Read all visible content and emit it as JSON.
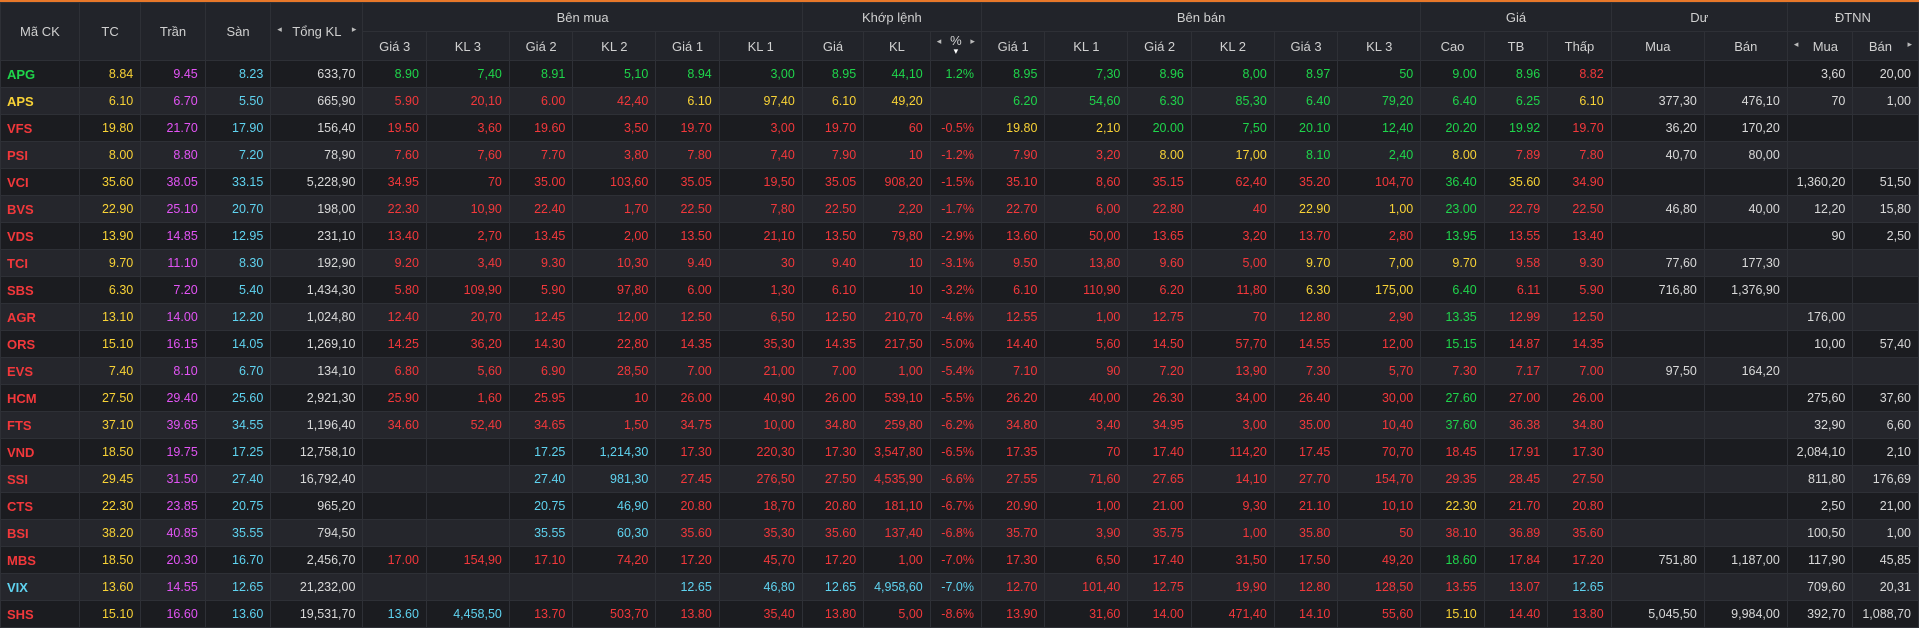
{
  "colors": {
    "up": "#1fd54b",
    "down": "#f2383b",
    "ref": "#f8d236",
    "ceil": "#e354f5",
    "floor": "#5fd3f0",
    "neutral": "#d9d9d9"
  },
  "headers": {
    "symbol": "Mã CK",
    "tc": "TC",
    "tran": "Trần",
    "san": "Sàn",
    "tong_kl": "Tổng KL",
    "ben_mua": "Bên mua",
    "khop_lenh": "Khớp lệnh",
    "ben_ban": "Bên bán",
    "gia": "Giá",
    "du": "Dư",
    "dtnn": "ĐTNN",
    "gia3": "Giá 3",
    "kl3": "KL 3",
    "gia2": "Giá 2",
    "kl2": "KL 2",
    "gia1": "Giá 1",
    "kl1": "KL 1",
    "m_gia": "Giá",
    "m_kl": "KL",
    "m_pct": "%",
    "cao": "Cao",
    "tb": "TB",
    "thap": "Thấp",
    "du_mua": "Mua",
    "du_ban": "Bán",
    "nn_mua": "Mua",
    "nn_ban": "Bán",
    "sort_icon": "▾",
    "left_arrow": "◂",
    "right_arrow": "▸"
  },
  "rows": [
    {
      "sym": [
        "APG",
        "u"
      ],
      "tc": "8.84",
      "tran": "9.45",
      "san": "8.23",
      "kl": "633,70",
      "b3": [
        "8.90",
        "7,40",
        "u"
      ],
      "b2": [
        "8.91",
        "5,10",
        "u"
      ],
      "b1": [
        "8.94",
        "3,00",
        "u"
      ],
      "m": [
        "8.95",
        "44,10",
        "1.2%",
        "u"
      ],
      "s1": [
        "8.95",
        "7,30",
        "u"
      ],
      "s2": [
        "8.96",
        "8,00",
        "u"
      ],
      "s3": [
        "8.97",
        "50",
        "u"
      ],
      "cao": [
        "9.00",
        "u"
      ],
      "tb": [
        "8.96",
        "u"
      ],
      "thap": [
        "8.82",
        "d"
      ],
      "dm": "",
      "db": "",
      "nm": "3,60",
      "nb": "20,00"
    },
    {
      "sym": [
        "APS",
        "r"
      ],
      "tc": "6.10",
      "tran": "6.70",
      "san": "5.50",
      "kl": "665,90",
      "b3": [
        "5.90",
        "20,10",
        "d"
      ],
      "b2": [
        "6.00",
        "42,40",
        "d"
      ],
      "b1": [
        "6.10",
        "97,40",
        "r"
      ],
      "m": [
        "6.10",
        "49,20",
        "",
        "r"
      ],
      "s1": [
        "6.20",
        "54,60",
        "u"
      ],
      "s2": [
        "6.30",
        "85,30",
        "u"
      ],
      "s3": [
        "6.40",
        "79,20",
        "u"
      ],
      "cao": [
        "6.40",
        "u"
      ],
      "tb": [
        "6.25",
        "u"
      ],
      "thap": [
        "6.10",
        "r"
      ],
      "dm": "377,30",
      "db": "476,10",
      "nm": "70",
      "nb": "1,00"
    },
    {
      "sym": [
        "VFS",
        "d"
      ],
      "tc": "19.80",
      "tran": "21.70",
      "san": "17.90",
      "kl": "156,40",
      "b3": [
        "19.50",
        "3,60",
        "d"
      ],
      "b2": [
        "19.60",
        "3,50",
        "d"
      ],
      "b1": [
        "19.70",
        "3,00",
        "d"
      ],
      "m": [
        "19.70",
        "60",
        "-0.5%",
        "d"
      ],
      "s1": [
        "19.80",
        "2,10",
        "r"
      ],
      "s2": [
        "20.00",
        "7,50",
        "u"
      ],
      "s3": [
        "20.10",
        "12,40",
        "u"
      ],
      "cao": [
        "20.20",
        "u"
      ],
      "tb": [
        "19.92",
        "u"
      ],
      "thap": [
        "19.70",
        "d"
      ],
      "dm": "36,20",
      "db": "170,20",
      "nm": "",
      "nb": ""
    },
    {
      "sym": [
        "PSI",
        "d"
      ],
      "tc": "8.00",
      "tran": "8.80",
      "san": "7.20",
      "kl": "78,90",
      "b3": [
        "7.60",
        "7,60",
        "d"
      ],
      "b2": [
        "7.70",
        "3,80",
        "d"
      ],
      "b1": [
        "7.80",
        "7,40",
        "d"
      ],
      "m": [
        "7.90",
        "10",
        "-1.2%",
        "d"
      ],
      "s1": [
        "7.90",
        "3,20",
        "d"
      ],
      "s2": [
        "8.00",
        "17,00",
        "r"
      ],
      "s3": [
        "8.10",
        "2,40",
        "u"
      ],
      "cao": [
        "8.00",
        "r"
      ],
      "tb": [
        "7.89",
        "d"
      ],
      "thap": [
        "7.80",
        "d"
      ],
      "dm": "40,70",
      "db": "80,00",
      "nm": "",
      "nb": ""
    },
    {
      "sym": [
        "VCI",
        "d"
      ],
      "tc": "35.60",
      "tran": "38.05",
      "san": "33.15",
      "kl": "5,228,90",
      "b3": [
        "34.95",
        "70",
        "d"
      ],
      "b2": [
        "35.00",
        "103,60",
        "d"
      ],
      "b1": [
        "35.05",
        "19,50",
        "d"
      ],
      "m": [
        "35.05",
        "908,20",
        "-1.5%",
        "d"
      ],
      "s1": [
        "35.10",
        "8,60",
        "d"
      ],
      "s2": [
        "35.15",
        "62,40",
        "d"
      ],
      "s3": [
        "35.20",
        "104,70",
        "d"
      ],
      "cao": [
        "36.40",
        "u"
      ],
      "tb": [
        "35.60",
        "r"
      ],
      "thap": [
        "34.90",
        "d"
      ],
      "dm": "",
      "db": "",
      "nm": "1,360,20",
      "nb": "51,50"
    },
    {
      "sym": [
        "BVS",
        "d"
      ],
      "tc": "22.90",
      "tran": "25.10",
      "san": "20.70",
      "kl": "198,00",
      "b3": [
        "22.30",
        "10,90",
        "d"
      ],
      "b2": [
        "22.40",
        "1,70",
        "d"
      ],
      "b1": [
        "22.50",
        "7,80",
        "d"
      ],
      "m": [
        "22.50",
        "2,20",
        "-1.7%",
        "d"
      ],
      "s1": [
        "22.70",
        "6,00",
        "d"
      ],
      "s2": [
        "22.80",
        "40",
        "d"
      ],
      "s3": [
        "22.90",
        "1,00",
        "r"
      ],
      "cao": [
        "23.00",
        "u"
      ],
      "tb": [
        "22.79",
        "d"
      ],
      "thap": [
        "22.50",
        "d"
      ],
      "dm": "46,80",
      "db": "40,00",
      "nm": "12,20",
      "nb": "15,80"
    },
    {
      "sym": [
        "VDS",
        "d"
      ],
      "tc": "13.90",
      "tran": "14.85",
      "san": "12.95",
      "kl": "231,10",
      "b3": [
        "13.40",
        "2,70",
        "d"
      ],
      "b2": [
        "13.45",
        "2,00",
        "d"
      ],
      "b1": [
        "13.50",
        "21,10",
        "d"
      ],
      "m": [
        "13.50",
        "79,80",
        "-2.9%",
        "d"
      ],
      "s1": [
        "13.60",
        "50,00",
        "d"
      ],
      "s2": [
        "13.65",
        "3,20",
        "d"
      ],
      "s3": [
        "13.70",
        "2,80",
        "d"
      ],
      "cao": [
        "13.95",
        "u"
      ],
      "tb": [
        "13.55",
        "d"
      ],
      "thap": [
        "13.40",
        "d"
      ],
      "dm": "",
      "db": "",
      "nm": "90",
      "nb": "2,50"
    },
    {
      "sym": [
        "TCI",
        "d"
      ],
      "tc": "9.70",
      "tran": "11.10",
      "san": "8.30",
      "kl": "192,90",
      "b3": [
        "9.20",
        "3,40",
        "d"
      ],
      "b2": [
        "9.30",
        "10,30",
        "d"
      ],
      "b1": [
        "9.40",
        "30",
        "d"
      ],
      "m": [
        "9.40",
        "10",
        "-3.1%",
        "d"
      ],
      "s1": [
        "9.50",
        "13,80",
        "d"
      ],
      "s2": [
        "9.60",
        "5,00",
        "d"
      ],
      "s3": [
        "9.70",
        "7,00",
        "r"
      ],
      "cao": [
        "9.70",
        "r"
      ],
      "tb": [
        "9.58",
        "d"
      ],
      "thap": [
        "9.30",
        "d"
      ],
      "dm": "77,60",
      "db": "177,30",
      "nm": "",
      "nb": ""
    },
    {
      "sym": [
        "SBS",
        "d"
      ],
      "tc": "6.30",
      "tran": "7.20",
      "san": "5.40",
      "kl": "1,434,30",
      "b3": [
        "5.80",
        "109,90",
        "d"
      ],
      "b2": [
        "5.90",
        "97,80",
        "d"
      ],
      "b1": [
        "6.00",
        "1,30",
        "d"
      ],
      "m": [
        "6.10",
        "10",
        "-3.2%",
        "d"
      ],
      "s1": [
        "6.10",
        "110,90",
        "d"
      ],
      "s2": [
        "6.20",
        "11,80",
        "d"
      ],
      "s3": [
        "6.30",
        "175,00",
        "r"
      ],
      "cao": [
        "6.40",
        "u"
      ],
      "tb": [
        "6.11",
        "d"
      ],
      "thap": [
        "5.90",
        "d"
      ],
      "dm": "716,80",
      "db": "1,376,90",
      "nm": "",
      "nb": ""
    },
    {
      "sym": [
        "AGR",
        "d"
      ],
      "tc": "13.10",
      "tran": "14.00",
      "san": "12.20",
      "kl": "1,024,80",
      "b3": [
        "12.40",
        "20,70",
        "d"
      ],
      "b2": [
        "12.45",
        "12,00",
        "d"
      ],
      "b1": [
        "12.50",
        "6,50",
        "d"
      ],
      "m": [
        "12.50",
        "210,70",
        "-4.6%",
        "d"
      ],
      "s1": [
        "12.55",
        "1,00",
        "d"
      ],
      "s2": [
        "12.75",
        "70",
        "d"
      ],
      "s3": [
        "12.80",
        "2,90",
        "d"
      ],
      "cao": [
        "13.35",
        "u"
      ],
      "tb": [
        "12.99",
        "d"
      ],
      "thap": [
        "12.50",
        "d"
      ],
      "dm": "",
      "db": "",
      "nm": "176,00",
      "nb": ""
    },
    {
      "sym": [
        "ORS",
        "d"
      ],
      "tc": "15.10",
      "tran": "16.15",
      "san": "14.05",
      "kl": "1,269,10",
      "b3": [
        "14.25",
        "36,20",
        "d"
      ],
      "b2": [
        "14.30",
        "22,80",
        "d"
      ],
      "b1": [
        "14.35",
        "35,30",
        "d"
      ],
      "m": [
        "14.35",
        "217,50",
        "-5.0%",
        "d"
      ],
      "s1": [
        "14.40",
        "5,60",
        "d"
      ],
      "s2": [
        "14.50",
        "57,70",
        "d"
      ],
      "s3": [
        "14.55",
        "12,00",
        "d"
      ],
      "cao": [
        "15.15",
        "u"
      ],
      "tb": [
        "14.87",
        "d"
      ],
      "thap": [
        "14.35",
        "d"
      ],
      "dm": "",
      "db": "",
      "nm": "10,00",
      "nb": "57,40"
    },
    {
      "sym": [
        "EVS",
        "d"
      ],
      "tc": "7.40",
      "tran": "8.10",
      "san": "6.70",
      "kl": "134,10",
      "b3": [
        "6.80",
        "5,60",
        "d"
      ],
      "b2": [
        "6.90",
        "28,50",
        "d"
      ],
      "b1": [
        "7.00",
        "21,00",
        "d"
      ],
      "m": [
        "7.00",
        "1,00",
        "-5.4%",
        "d"
      ],
      "s1": [
        "7.10",
        "90",
        "d"
      ],
      "s2": [
        "7.20",
        "13,90",
        "d"
      ],
      "s3": [
        "7.30",
        "5,70",
        "d"
      ],
      "cao": [
        "7.30",
        "d"
      ],
      "tb": [
        "7.17",
        "d"
      ],
      "thap": [
        "7.00",
        "d"
      ],
      "dm": "97,50",
      "db": "164,20",
      "nm": "",
      "nb": ""
    },
    {
      "sym": [
        "HCM",
        "d"
      ],
      "tc": "27.50",
      "tran": "29.40",
      "san": "25.60",
      "kl": "2,921,30",
      "b3": [
        "25.90",
        "1,60",
        "d"
      ],
      "b2": [
        "25.95",
        "10",
        "d"
      ],
      "b1": [
        "26.00",
        "40,90",
        "d"
      ],
      "m": [
        "26.00",
        "539,10",
        "-5.5%",
        "d"
      ],
      "s1": [
        "26.20",
        "40,00",
        "d"
      ],
      "s2": [
        "26.30",
        "34,00",
        "d"
      ],
      "s3": [
        "26.40",
        "30,00",
        "d"
      ],
      "cao": [
        "27.60",
        "u"
      ],
      "tb": [
        "27.00",
        "d"
      ],
      "thap": [
        "26.00",
        "d"
      ],
      "dm": "",
      "db": "",
      "nm": "275,60",
      "nb": "37,60"
    },
    {
      "sym": [
        "FTS",
        "d"
      ],
      "tc": "37.10",
      "tran": "39.65",
      "san": "34.55",
      "kl": "1,196,40",
      "b3": [
        "34.60",
        "52,40",
        "d"
      ],
      "b2": [
        "34.65",
        "1,50",
        "d"
      ],
      "b1": [
        "34.75",
        "10,00",
        "d"
      ],
      "m": [
        "34.80",
        "259,80",
        "-6.2%",
        "d"
      ],
      "s1": [
        "34.80",
        "3,40",
        "d"
      ],
      "s2": [
        "34.95",
        "3,00",
        "d"
      ],
      "s3": [
        "35.00",
        "10,40",
        "d"
      ],
      "cao": [
        "37.60",
        "u"
      ],
      "tb": [
        "36.38",
        "d"
      ],
      "thap": [
        "34.80",
        "d"
      ],
      "dm": "",
      "db": "",
      "nm": "32,90",
      "nb": "6,60"
    },
    {
      "sym": [
        "VND",
        "d"
      ],
      "tc": "18.50",
      "tran": "19.75",
      "san": "17.25",
      "kl": "12,758,10",
      "b3": [
        "",
        "",
        "d"
      ],
      "b2": [
        "17.25",
        "1,214,30",
        "f"
      ],
      "b1": [
        "17.30",
        "220,30",
        "d"
      ],
      "m": [
        "17.30",
        "3,547,80",
        "-6.5%",
        "d"
      ],
      "s1": [
        "17.35",
        "70",
        "d"
      ],
      "s2": [
        "17.40",
        "114,20",
        "d"
      ],
      "s3": [
        "17.45",
        "70,70",
        "d"
      ],
      "cao": [
        "18.45",
        "d"
      ],
      "tb": [
        "17.91",
        "d"
      ],
      "thap": [
        "17.30",
        "d"
      ],
      "dm": "",
      "db": "",
      "nm": "2,084,10",
      "nb": "2,10"
    },
    {
      "sym": [
        "SSI",
        "d"
      ],
      "tc": "29.45",
      "tran": "31.50",
      "san": "27.40",
      "kl": "16,792,40",
      "b3": [
        "",
        "",
        "d"
      ],
      "b2": [
        "27.40",
        "981,30",
        "f"
      ],
      "b1": [
        "27.45",
        "276,50",
        "d"
      ],
      "m": [
        "27.50",
        "4,535,90",
        "-6.6%",
        "d"
      ],
      "s1": [
        "27.55",
        "71,60",
        "d"
      ],
      "s2": [
        "27.65",
        "14,10",
        "d"
      ],
      "s3": [
        "27.70",
        "154,70",
        "d"
      ],
      "cao": [
        "29.35",
        "d"
      ],
      "tb": [
        "28.45",
        "d"
      ],
      "thap": [
        "27.50",
        "d"
      ],
      "dm": "",
      "db": "",
      "nm": "811,80",
      "nb": "176,69"
    },
    {
      "sym": [
        "CTS",
        "d"
      ],
      "tc": "22.30",
      "tran": "23.85",
      "san": "20.75",
      "kl": "965,20",
      "b3": [
        "",
        "",
        "d"
      ],
      "b2": [
        "20.75",
        "46,90",
        "f"
      ],
      "b1": [
        "20.80",
        "18,70",
        "d"
      ],
      "m": [
        "20.80",
        "181,10",
        "-6.7%",
        "d"
      ],
      "s1": [
        "20.90",
        "1,00",
        "d"
      ],
      "s2": [
        "21.00",
        "9,30",
        "d"
      ],
      "s3": [
        "21.10",
        "10,10",
        "d"
      ],
      "cao": [
        "22.30",
        "r"
      ],
      "tb": [
        "21.70",
        "d"
      ],
      "thap": [
        "20.80",
        "d"
      ],
      "dm": "",
      "db": "",
      "nm": "2,50",
      "nb": "21,00"
    },
    {
      "sym": [
        "BSI",
        "d"
      ],
      "tc": "38.20",
      "tran": "40.85",
      "san": "35.55",
      "kl": "794,50",
      "b3": [
        "",
        "",
        "d"
      ],
      "b2": [
        "35.55",
        "60,30",
        "f"
      ],
      "b1": [
        "35.60",
        "35,30",
        "d"
      ],
      "m": [
        "35.60",
        "137,40",
        "-6.8%",
        "d"
      ],
      "s1": [
        "35.70",
        "3,90",
        "d"
      ],
      "s2": [
        "35.75",
        "1,00",
        "d"
      ],
      "s3": [
        "35.80",
        "50",
        "d"
      ],
      "cao": [
        "38.10",
        "d"
      ],
      "tb": [
        "36.89",
        "d"
      ],
      "thap": [
        "35.60",
        "d"
      ],
      "dm": "",
      "db": "",
      "nm": "100,50",
      "nb": "1,00"
    },
    {
      "sym": [
        "MBS",
        "d"
      ],
      "tc": "18.50",
      "tran": "20.30",
      "san": "16.70",
      "kl": "2,456,70",
      "b3": [
        "17.00",
        "154,90",
        "d"
      ],
      "b2": [
        "17.10",
        "74,20",
        "d"
      ],
      "b1": [
        "17.20",
        "45,70",
        "d"
      ],
      "m": [
        "17.20",
        "1,00",
        "-7.0%",
        "d"
      ],
      "s1": [
        "17.30",
        "6,50",
        "d"
      ],
      "s2": [
        "17.40",
        "31,50",
        "d"
      ],
      "s3": [
        "17.50",
        "49,20",
        "d"
      ],
      "cao": [
        "18.60",
        "u"
      ],
      "tb": [
        "17.84",
        "d"
      ],
      "thap": [
        "17.20",
        "d"
      ],
      "dm": "751,80",
      "db": "1,187,00",
      "nm": "117,90",
      "nb": "45,85"
    },
    {
      "sym": [
        "VIX",
        "f"
      ],
      "tc": "13.60",
      "tran": "14.55",
      "san": "12.65",
      "kl": "21,232,00",
      "b3": [
        "",
        "",
        "d"
      ],
      "b2": [
        "",
        "",
        "d"
      ],
      "b1": [
        "12.65",
        "46,80",
        "f"
      ],
      "m": [
        "12.65",
        "4,958,60",
        "-7.0%",
        "f"
      ],
      "s1": [
        "12.70",
        "101,40",
        "d"
      ],
      "s2": [
        "12.75",
        "19,90",
        "d"
      ],
      "s3": [
        "12.80",
        "128,50",
        "d"
      ],
      "cao": [
        "13.55",
        "d"
      ],
      "tb": [
        "13.07",
        "d"
      ],
      "thap": [
        "12.65",
        "f"
      ],
      "dm": "",
      "db": "",
      "nm": "709,60",
      "nb": "20,31"
    },
    {
      "sym": [
        "SHS",
        "d"
      ],
      "tc": "15.10",
      "tran": "16.60",
      "san": "13.60",
      "kl": "19,531,70",
      "b3": [
        "13.60",
        "4,458,50",
        "f"
      ],
      "b2": [
        "13.70",
        "503,70",
        "d"
      ],
      "b1": [
        "13.80",
        "35,40",
        "d"
      ],
      "m": [
        "13.80",
        "5,00",
        "-8.6%",
        "d"
      ],
      "s1": [
        "13.90",
        "31,60",
        "d"
      ],
      "s2": [
        "14.00",
        "471,40",
        "d"
      ],
      "s3": [
        "14.10",
        "55,60",
        "d"
      ],
      "cao": [
        "15.10",
        "r"
      ],
      "tb": [
        "14.40",
        "d"
      ],
      "thap": [
        "13.80",
        "d"
      ],
      "dm": "5,045,50",
      "db": "9,984,00",
      "nm": "392,70",
      "nb": "1,088,70"
    }
  ]
}
